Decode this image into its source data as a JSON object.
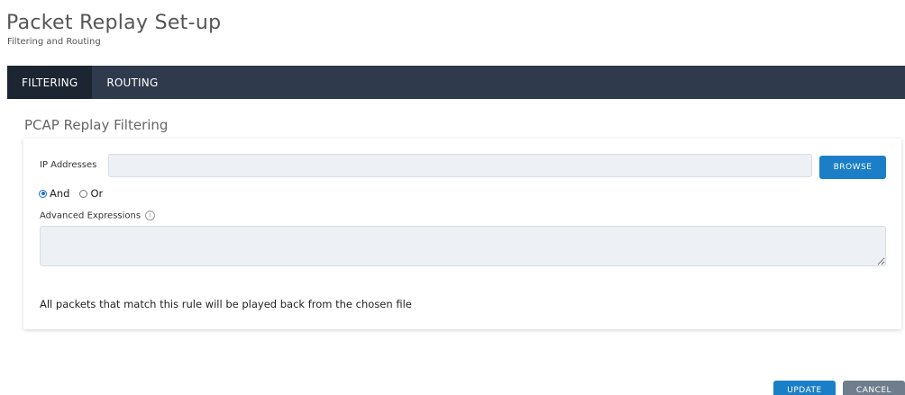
{
  "header": {
    "title": "Packet Replay Set-up",
    "subtitle": "Filtering and Routing"
  },
  "tabs": [
    {
      "label": "FILTERING",
      "active": true
    },
    {
      "label": "ROUTING",
      "active": false
    }
  ],
  "section": {
    "title": "PCAP Replay Filtering"
  },
  "form": {
    "ip_label": "IP Addresses",
    "ip_value": "",
    "browse_label": "BROWSE",
    "logic_options": [
      {
        "label": "And",
        "selected": true
      },
      {
        "label": "Or",
        "selected": false
      }
    ],
    "advanced_label": "Advanced Expressions",
    "advanced_value": "",
    "info_icon": "info-icon",
    "note": "All packets that match this rule will be played back from the chosen file"
  },
  "actions": {
    "update_label": "UPDATE",
    "cancel_label": "CANCEL"
  },
  "colors": {
    "tabbar": "#2f3b4c",
    "tab_active": "#1c2532",
    "primary_button": "#1a7fc6",
    "secondary_button": "#6f7d8c",
    "input_background": "#edf0f5"
  }
}
